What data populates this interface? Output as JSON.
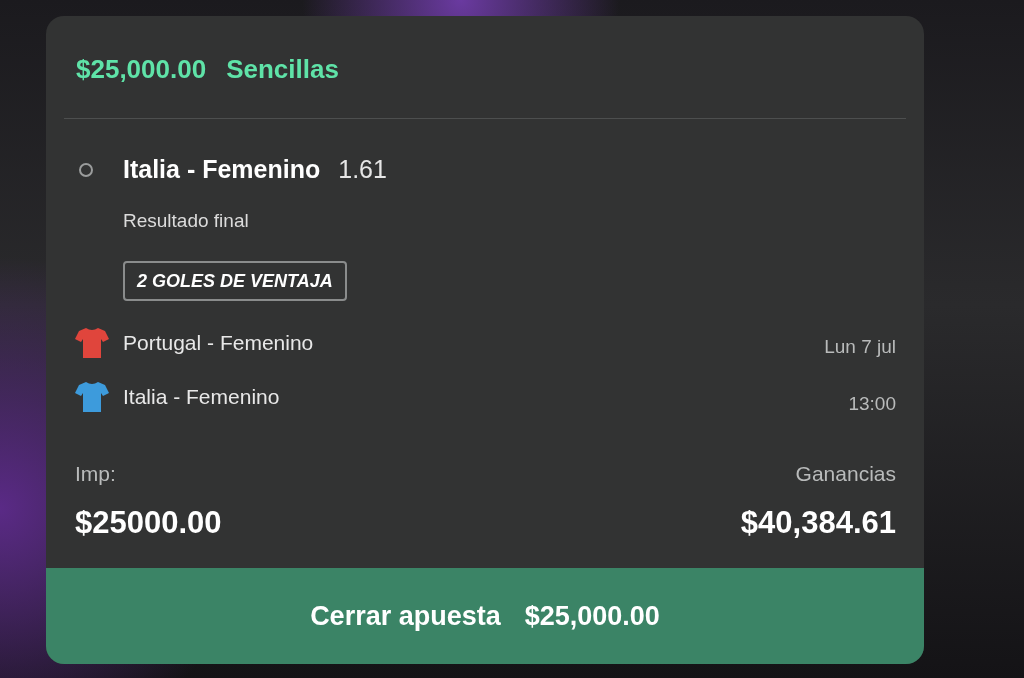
{
  "header": {
    "amount": "$25,000.00",
    "bet_type": "Sencillas"
  },
  "selection": {
    "pick": "Italia - Femenino",
    "odds": "1.61",
    "market": "Resultado final",
    "tag": "2 GOLES DE VENTAJA"
  },
  "teams": [
    {
      "name": "Portugal - Femenino",
      "color": "#e0453c"
    },
    {
      "name": "Italia - Femenino",
      "color": "#3d9bdc"
    }
  ],
  "kickoff": {
    "date": "Lun 7 jul",
    "time": "13:00"
  },
  "stake": {
    "label": "Imp:",
    "value": "$25000.00"
  },
  "winnings": {
    "label": "Ganancias",
    "value": "$40,384.61"
  },
  "cashout_button": {
    "label": "Cerrar apuesta",
    "amount": "$25,000.00"
  }
}
